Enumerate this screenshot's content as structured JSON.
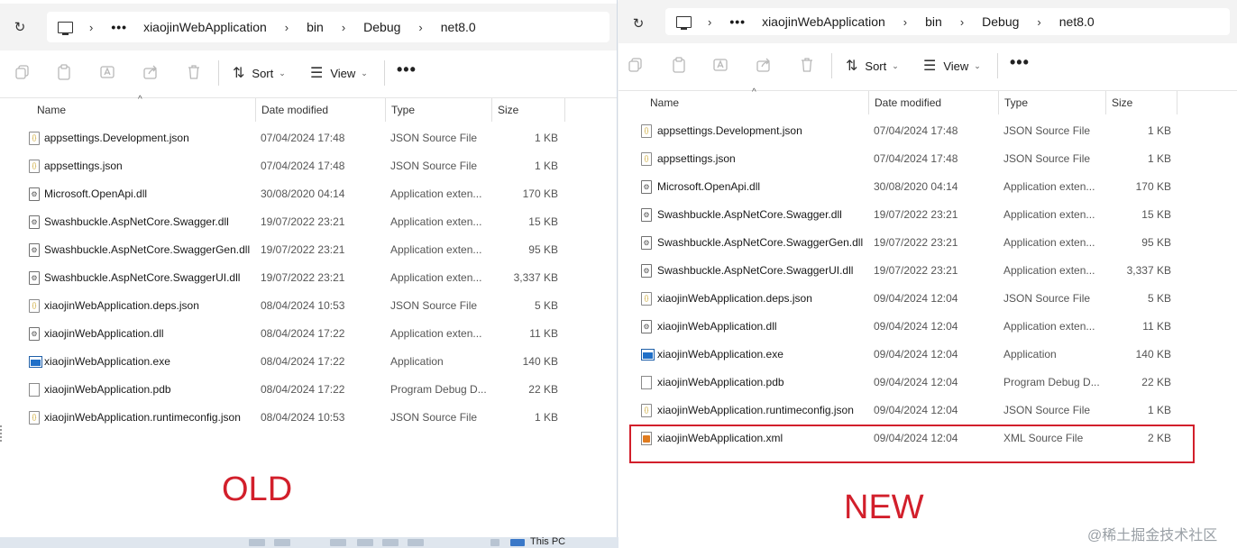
{
  "old_label": "OLD",
  "new_label": "NEW",
  "watermark": "@稀土掘金技术社区",
  "taskbar": {
    "label": "This PC"
  },
  "colors": {
    "accent_red": "#d21f2b",
    "exe_blue": "#1f6fc8"
  },
  "columns": {
    "name": "Name",
    "date": "Date modified",
    "type": "Type",
    "size": "Size"
  },
  "toolbar": {
    "sort": "Sort",
    "view": "View",
    "more": "•••"
  },
  "breadcrumb": {
    "ellipsis": "•••",
    "items": [
      "xiaojinWebApplication",
      "bin",
      "Debug",
      "net8.0"
    ]
  },
  "old": {
    "files": [
      {
        "icon": "json",
        "name": "appsettings.Development.json",
        "date": "07/04/2024 17:48",
        "type": "JSON Source File",
        "size": "1 KB"
      },
      {
        "icon": "json",
        "name": "appsettings.json",
        "date": "07/04/2024 17:48",
        "type": "JSON Source File",
        "size": "1 KB"
      },
      {
        "icon": "dll",
        "name": "Microsoft.OpenApi.dll",
        "date": "30/08/2020 04:14",
        "type": "Application exten...",
        "size": "170 KB"
      },
      {
        "icon": "dll",
        "name": "Swashbuckle.AspNetCore.Swagger.dll",
        "date": "19/07/2022 23:21",
        "type": "Application exten...",
        "size": "15 KB"
      },
      {
        "icon": "dll",
        "name": "Swashbuckle.AspNetCore.SwaggerGen.dll",
        "date": "19/07/2022 23:21",
        "type": "Application exten...",
        "size": "95 KB"
      },
      {
        "icon": "dll",
        "name": "Swashbuckle.AspNetCore.SwaggerUI.dll",
        "date": "19/07/2022 23:21",
        "type": "Application exten...",
        "size": "3,337 KB"
      },
      {
        "icon": "json",
        "name": "xiaojinWebApplication.deps.json",
        "date": "08/04/2024 10:53",
        "type": "JSON Source File",
        "size": "5 KB"
      },
      {
        "icon": "dll",
        "name": "xiaojinWebApplication.dll",
        "date": "08/04/2024 17:22",
        "type": "Application exten...",
        "size": "11 KB"
      },
      {
        "icon": "exe",
        "name": "xiaojinWebApplication.exe",
        "date": "08/04/2024 17:22",
        "type": "Application",
        "size": "140 KB"
      },
      {
        "icon": "pdb",
        "name": "xiaojinWebApplication.pdb",
        "date": "08/04/2024 17:22",
        "type": "Program Debug D...",
        "size": "22 KB"
      },
      {
        "icon": "json",
        "name": "xiaojinWebApplication.runtimeconfig.json",
        "date": "08/04/2024 10:53",
        "type": "JSON Source File",
        "size": "1 KB"
      }
    ]
  },
  "new": {
    "files": [
      {
        "icon": "json",
        "name": "appsettings.Development.json",
        "date": "07/04/2024 17:48",
        "type": "JSON Source File",
        "size": "1 KB"
      },
      {
        "icon": "json",
        "name": "appsettings.json",
        "date": "07/04/2024 17:48",
        "type": "JSON Source File",
        "size": "1 KB"
      },
      {
        "icon": "dll",
        "name": "Microsoft.OpenApi.dll",
        "date": "30/08/2020 04:14",
        "type": "Application exten...",
        "size": "170 KB"
      },
      {
        "icon": "dll",
        "name": "Swashbuckle.AspNetCore.Swagger.dll",
        "date": "19/07/2022 23:21",
        "type": "Application exten...",
        "size": "15 KB"
      },
      {
        "icon": "dll",
        "name": "Swashbuckle.AspNetCore.SwaggerGen.dll",
        "date": "19/07/2022 23:21",
        "type": "Application exten...",
        "size": "95 KB"
      },
      {
        "icon": "dll",
        "name": "Swashbuckle.AspNetCore.SwaggerUI.dll",
        "date": "19/07/2022 23:21",
        "type": "Application exten...",
        "size": "3,337 KB"
      },
      {
        "icon": "json",
        "name": "xiaojinWebApplication.deps.json",
        "date": "09/04/2024 12:04",
        "type": "JSON Source File",
        "size": "5 KB"
      },
      {
        "icon": "dll",
        "name": "xiaojinWebApplication.dll",
        "date": "09/04/2024 12:04",
        "type": "Application exten...",
        "size": "11 KB"
      },
      {
        "icon": "exe",
        "name": "xiaojinWebApplication.exe",
        "date": "09/04/2024 12:04",
        "type": "Application",
        "size": "140 KB"
      },
      {
        "icon": "pdb",
        "name": "xiaojinWebApplication.pdb",
        "date": "09/04/2024 12:04",
        "type": "Program Debug D...",
        "size": "22 KB"
      },
      {
        "icon": "json",
        "name": "xiaojinWebApplication.runtimeconfig.json",
        "date": "09/04/2024 12:04",
        "type": "JSON Source File",
        "size": "1 KB"
      },
      {
        "icon": "xml",
        "name": "xiaojinWebApplication.xml",
        "date": "09/04/2024 12:04",
        "type": "XML Source File",
        "size": "2 KB"
      }
    ]
  }
}
